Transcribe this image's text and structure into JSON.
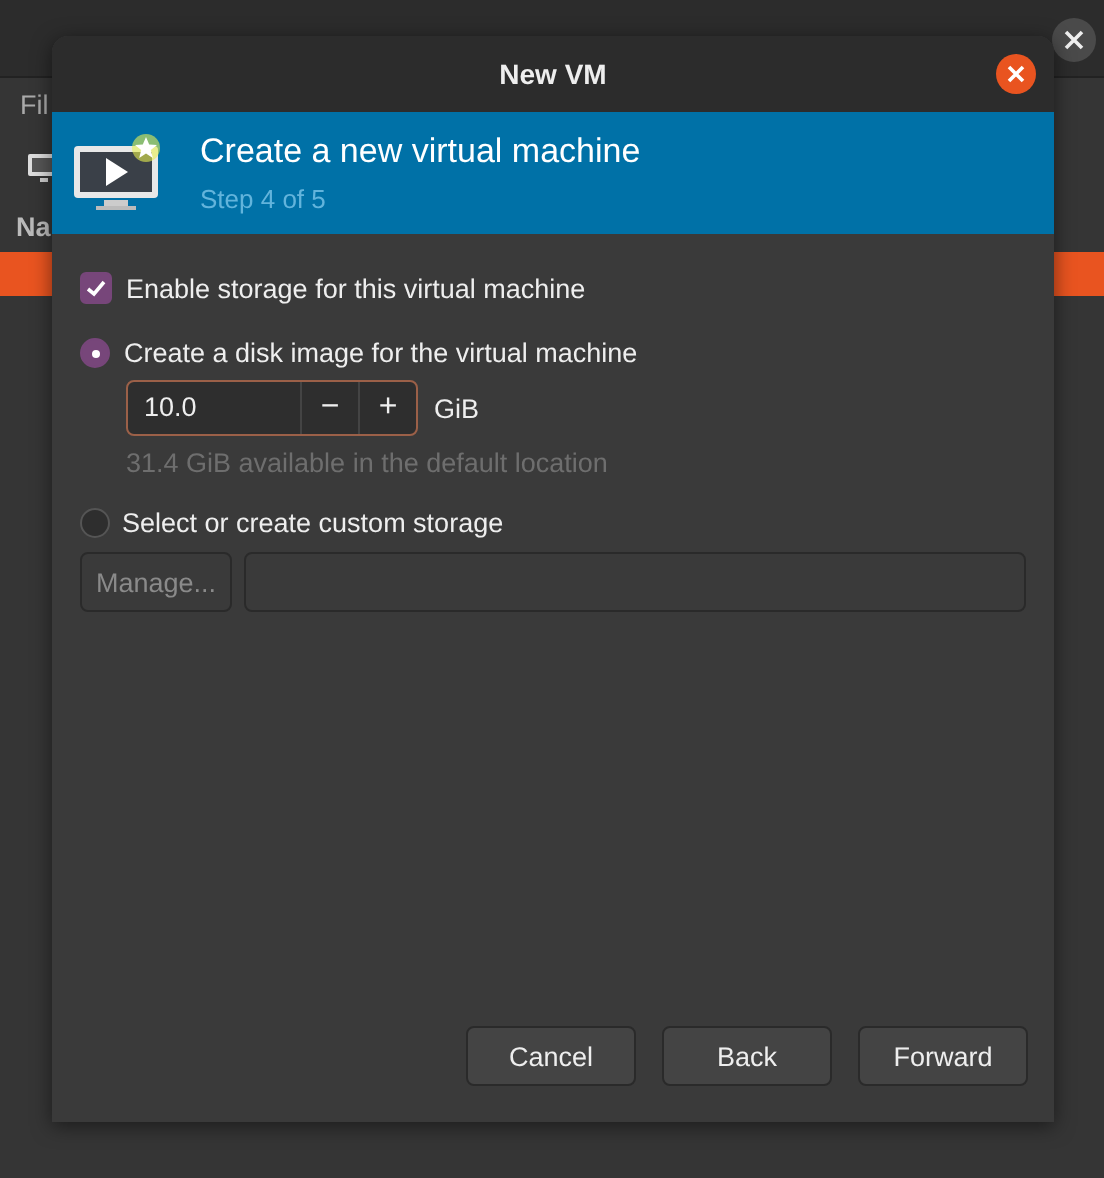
{
  "background_window": {
    "menu_fragment": "Fil",
    "column_fragment": "Na"
  },
  "dialog": {
    "title": "New VM"
  },
  "banner": {
    "title": "Create a new virtual machine",
    "subtitle": "Step 4 of 5"
  },
  "enable_storage": {
    "label": "Enable storage for this virtual machine",
    "checked": true
  },
  "options": [
    {
      "kind": "disk_image",
      "label": "Create a disk image for the virtual machine",
      "selected": true,
      "size": "10.0",
      "decrement": "−",
      "increment": "+",
      "unit": "GiB",
      "note": "31.4 GiB available in the default location"
    },
    {
      "kind": "custom",
      "label": "Select or create custom storage",
      "selected": false,
      "button": "Manage..."
    }
  ],
  "buttons": [
    "Cancel",
    "Back",
    "Forward"
  ]
}
